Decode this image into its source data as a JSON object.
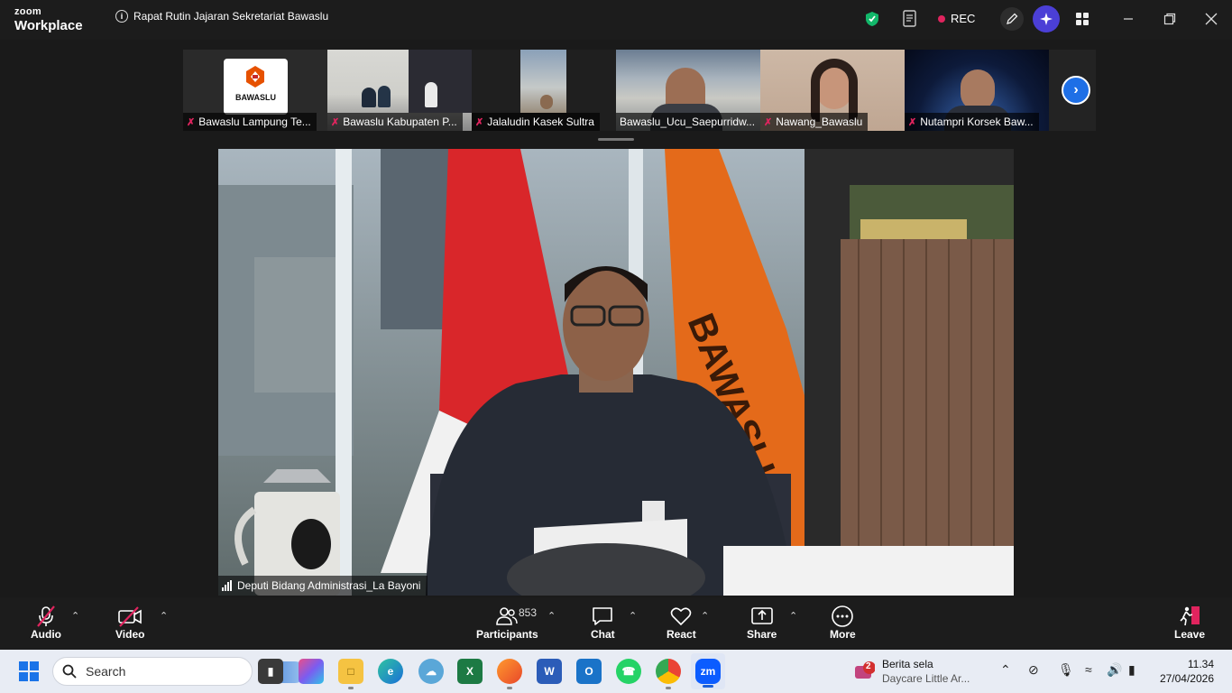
{
  "app": {
    "brand_top": "zoom",
    "brand_bottom": "Workplace"
  },
  "meeting": {
    "title": "Rapat Rutin Jajaran Sekretariat Bawaslu",
    "rec_label": "REC"
  },
  "colors": {
    "accent": "#1e6fe6",
    "mute": "#e0245e",
    "shield": "#12b76a"
  },
  "gallery": [
    {
      "name": "Bawaslu Lampung Te...",
      "logo_text": "BAWASLU"
    },
    {
      "name": "Bawaslu Kabupaten P..."
    },
    {
      "name": "Jalaludin Kasek Sultra"
    },
    {
      "name": "Bawaslu_Ucu_Saepurridw..."
    },
    {
      "name": "Nawang_Bawaslu"
    },
    {
      "name": "Nutampri Korsek Baw..."
    }
  ],
  "main_speaker": {
    "name": "Deputi Bidang Administrasi_La Bayoni"
  },
  "toolbar": {
    "audio": "Audio",
    "video": "Video",
    "participants": "Participants",
    "participants_count": "853",
    "chat": "Chat",
    "react": "React",
    "share": "Share",
    "more": "More",
    "leave": "Leave"
  },
  "taskbar": {
    "search_placeholder": "Search",
    "news_badge": "2",
    "news_title": "Berita sela",
    "news_sub": "Daycare Little Ar...",
    "time": "11.34",
    "date": "27/04/2026"
  }
}
